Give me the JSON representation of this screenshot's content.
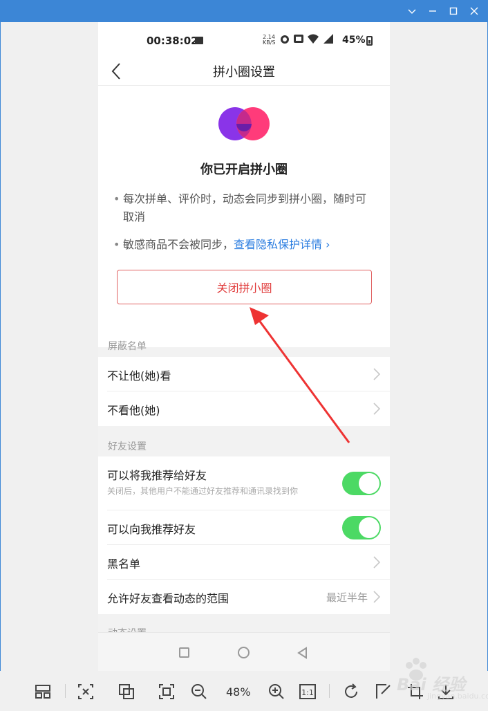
{
  "phone": {
    "status": {
      "time": "00:38:02",
      "speed": "2.14\nKB/S",
      "battery": "45%"
    },
    "nav": {
      "back_icon": "chevron-left-icon",
      "title": "拼小圈设置"
    },
    "hero": {
      "title": "你已开启拼小圈",
      "bullet1": "每次拼单、评价时，动态会同步到拼小圈，随时可取消",
      "bullet2_text": "敏感商品不会被同步，",
      "bullet2_link": "查看隐私保护详情 ›",
      "close_button": "关闭拼小圈",
      "logo_colors": [
        "#8a34e8",
        "#ff3b7a"
      ]
    },
    "sections": {
      "block_list": "屏蔽名单",
      "friend_settings": "好友设置",
      "moments_settings": "动态设置"
    },
    "rows": {
      "hide_from": "不让他(她)看",
      "hide_them": "不看他(她)",
      "recommend_me": "可以将我推荐给好友",
      "recommend_me_sub": "关闭后，其他用户不能通过好友推荐和通讯录找到你",
      "recommend_me_on": true,
      "recommend_to_me": "可以向我推荐好友",
      "recommend_to_me_on": true,
      "blacklist": "黑名单",
      "moments_range": "允许好友查看动态的范围",
      "moments_range_value": "最近半年"
    },
    "toggle_color": "#4cd964"
  },
  "toolbar": {
    "zoom": "48%"
  },
  "watermark": {
    "text": "Bai 经验",
    "sub": "jingyan.baidu.com"
  }
}
